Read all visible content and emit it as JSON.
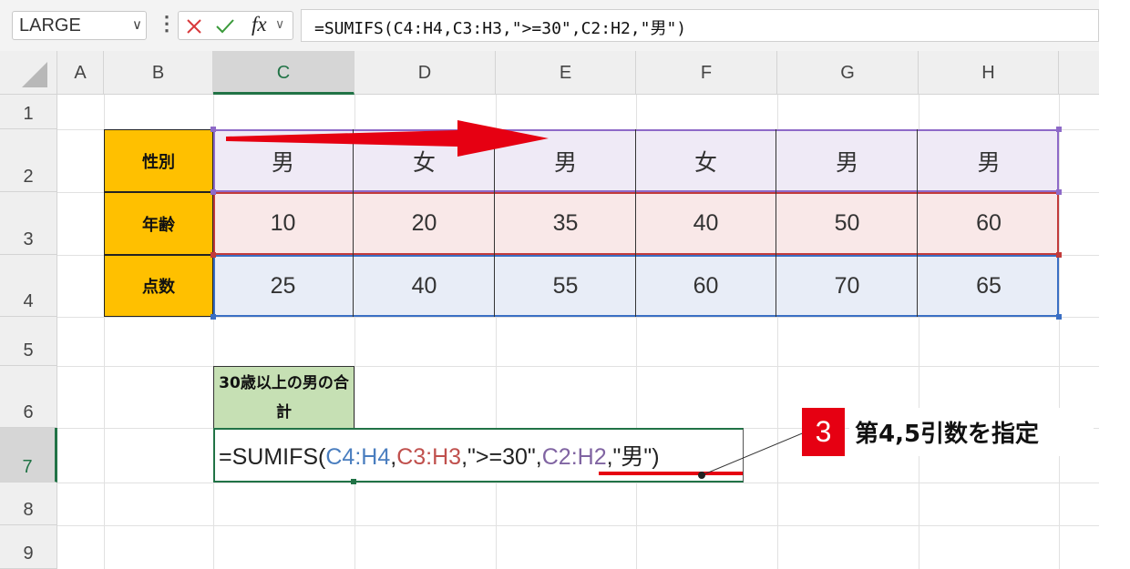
{
  "formula_bar": {
    "name_box": "LARGE",
    "name_box_chevron": "∨",
    "menu_dots": "⋮",
    "fx_label": "fx",
    "fx_chevron": "∨",
    "formula": "=SUMIFS(C4:H4,C3:H3,\">=30\",C2:H2,\"男\")"
  },
  "columns": [
    "A",
    "B",
    "C",
    "D",
    "E",
    "F",
    "G",
    "H"
  ],
  "selected_column": "C",
  "rows": [
    "1",
    "2",
    "3",
    "4",
    "5",
    "6",
    "7",
    "8",
    "9"
  ],
  "selected_row": "7",
  "table": {
    "labels": [
      "性別",
      "年齢",
      "点数"
    ],
    "gender": [
      "男",
      "女",
      "男",
      "女",
      "男",
      "男"
    ],
    "age": [
      "10",
      "20",
      "35",
      "40",
      "50",
      "60"
    ],
    "score": [
      "25",
      "40",
      "55",
      "60",
      "70",
      "65"
    ],
    "band_colors": {
      "gender": "#efeaf6",
      "age": "#f9e8e8",
      "score": "#e8edf7"
    },
    "border_colors": {
      "gender": "#8e6ac8",
      "age": "#c23b3b",
      "score": "#3a6fc4"
    }
  },
  "result_header": "30歳以上の男の合計",
  "edit_formula": {
    "prefix": "=SUMIFS(",
    "ref1": "C4:H4",
    "comma1": ",",
    "ref2": "C3:H3",
    "middle": ",\">=30\",",
    "ref3": "C2:H2",
    "suffix": ",\"男\")",
    "colors": {
      "ref1": "#4a7ebf",
      "ref2": "#c0504d",
      "ref3": "#8064a2",
      "accent": "#e60012"
    }
  },
  "callout": {
    "number": "3",
    "text": "第4,5引数を指定"
  }
}
